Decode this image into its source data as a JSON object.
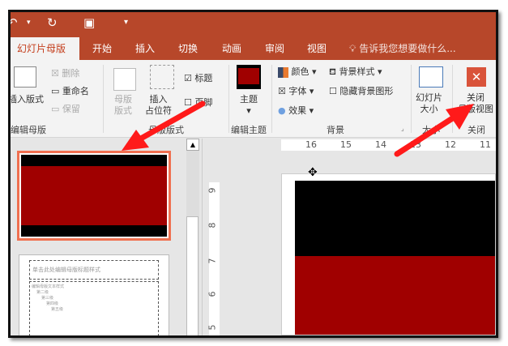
{
  "qat": {
    "undo": "↶",
    "redo": "↻",
    "present": "▣",
    "more": "▾"
  },
  "tabs": [
    "幻灯片母版",
    "开始",
    "插入",
    "切换",
    "动画",
    "审阅",
    "视图"
  ],
  "tell_me": "告诉我您想要做什么...",
  "ribbon": {
    "edit_master": {
      "insert_layout": "插入版式",
      "delete": "删除",
      "rename": "重命名",
      "preserve": "保留",
      "label": "编辑母版"
    },
    "master_layout": {
      "master_layout": "母版\n版式",
      "insert_placeholder": "插入\n占位符",
      "title": "标题",
      "footer": "页脚",
      "label": "母版版式"
    },
    "edit_theme": {
      "themes": "主题",
      "label": "编辑主题"
    },
    "background": {
      "colors": "颜色",
      "fonts": "字体",
      "effects": "效果",
      "bg_styles": "背景样式",
      "hide_bg": "隐藏背景图形",
      "label": "背景"
    },
    "size": {
      "slide_size": "幻灯片\n大小",
      "label": "大小"
    },
    "close": {
      "close_master": "关闭\n母版视图",
      "label": "关闭"
    }
  },
  "thumb2_title": "单击此处编辑母版标题样式",
  "thumb2_levels": [
    "编辑母版文本样式",
    "第二级",
    "第三级",
    "第四级",
    "第五级"
  ],
  "hruler": [
    "16",
    "15",
    "14",
    "13",
    "12",
    "11"
  ],
  "vruler": [
    "9",
    "8",
    "7",
    "6",
    "5"
  ],
  "colors": {
    "accent": "#b7472a",
    "slide_red": "#a00000",
    "selection": "#f07050",
    "arrow": "#ff1a1a"
  }
}
